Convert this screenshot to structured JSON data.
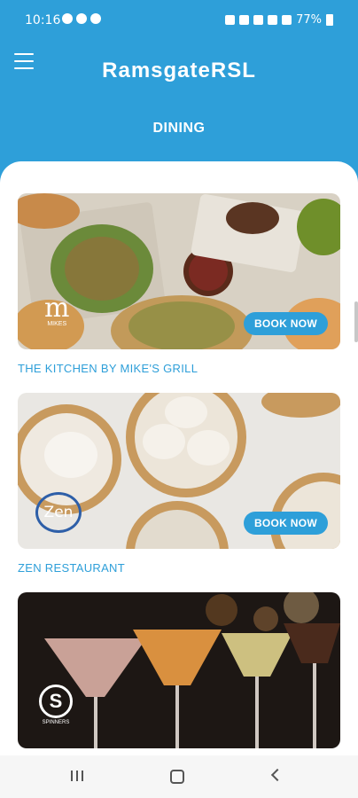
{
  "status_bar": {
    "time": "10:16",
    "battery": "77%"
  },
  "header": {
    "title": "RamsgateRSL"
  },
  "page": {
    "title": "DINING"
  },
  "venues": [
    {
      "name": "THE KITCHEN BY MIKE'S GRILL",
      "book_label": "BOOK NOW",
      "logo_text": "m",
      "logo_subtext": "MIKES"
    },
    {
      "name": "ZEN RESTAURANT",
      "book_label": "BOOK NOW",
      "logo_text": "Zen"
    },
    {
      "name": "",
      "logo_text": "S",
      "logo_subtext": "SPINNERS"
    }
  ],
  "colors": {
    "primary": "#2e9fd9",
    "background": "#ffffff"
  }
}
